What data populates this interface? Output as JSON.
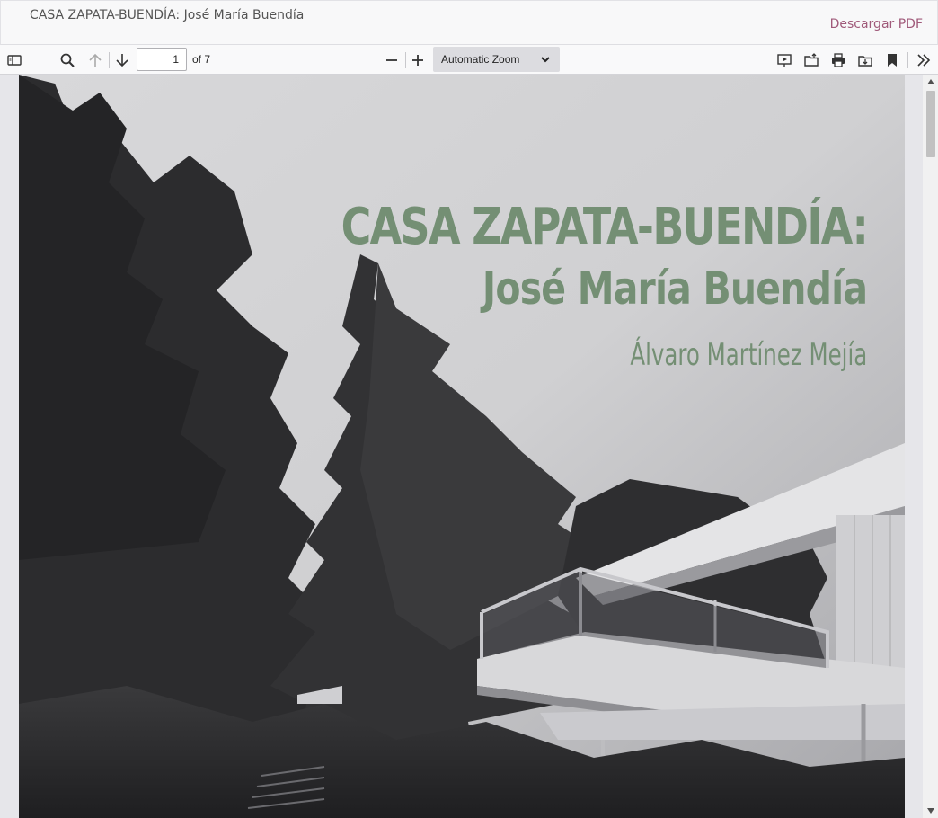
{
  "header": {
    "document_title": "CASA ZAPATA-BUENDÍA: José María Buendía",
    "download_label": "Descargar PDF"
  },
  "toolbar": {
    "current_page": "1",
    "page_count_label": "of 7",
    "zoom_value": "Automatic Zoom",
    "icons": [
      "sidebar-toggle-icon",
      "search-icon",
      "arrow-up-icon",
      "arrow-down-icon",
      "minus-icon",
      "plus-icon",
      "chevron-down-icon",
      "presentation-icon",
      "open-file-icon",
      "print-icon",
      "download-icon",
      "bookmark-icon",
      "double-chevron-right-icon"
    ]
  },
  "page": {
    "title_line1": "CASA ZAPATA-BUENDÍA:",
    "title_line2": "José María Buendía",
    "author": "Álvaro Martínez Mejía",
    "title_color": "#748f74"
  },
  "colors": {
    "download_link": "#a05a7a",
    "toolbar_bg": "#f9f9fa",
    "zoom_bg": "#dcdce0"
  }
}
